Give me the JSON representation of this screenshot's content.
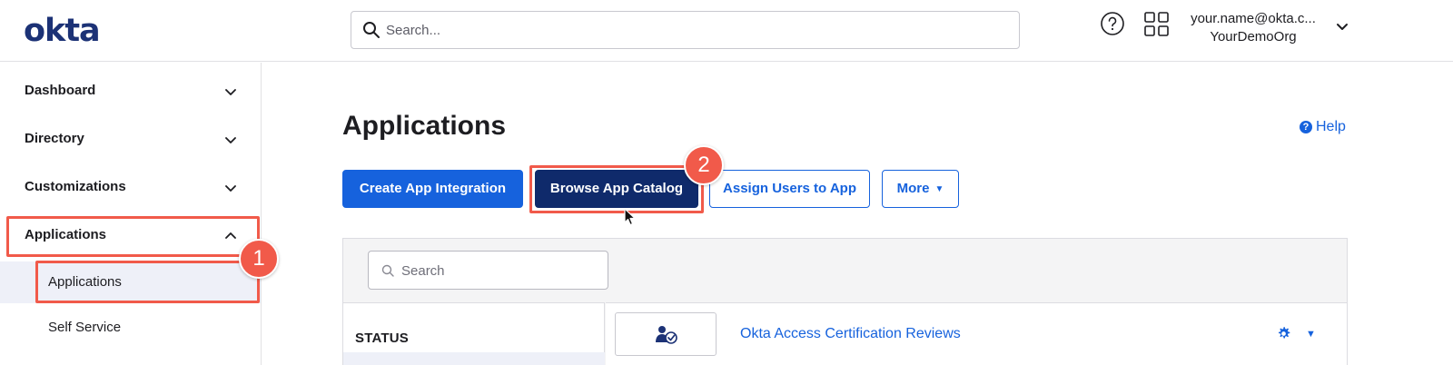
{
  "header": {
    "logo": "okta",
    "search_placeholder": "Search...",
    "user_email": "your.name@okta.c...",
    "user_org": "YourDemoOrg"
  },
  "sidebar": {
    "items": [
      {
        "label": "Dashboard",
        "expanded": false
      },
      {
        "label": "Directory",
        "expanded": false
      },
      {
        "label": "Customizations",
        "expanded": false
      },
      {
        "label": "Applications",
        "expanded": true
      }
    ],
    "subitems": [
      {
        "label": "Applications",
        "active": true
      },
      {
        "label": "Self Service",
        "active": false
      }
    ]
  },
  "main": {
    "title": "Applications",
    "help": "Help",
    "buttons": {
      "create": "Create App Integration",
      "browse": "Browse App Catalog",
      "assign": "Assign Users to App",
      "more": "More"
    },
    "panel": {
      "search_placeholder": "Search",
      "status_label": "STATUS",
      "apps": [
        {
          "name": "Okta Access Certification Reviews"
        }
      ]
    }
  },
  "annotations": {
    "step1": "1",
    "step2": "2"
  },
  "colors": {
    "primary": "#1662dd",
    "dark_button": "#0f2a6b",
    "brand": "#1c3276",
    "annotation": "#f15a4a"
  }
}
